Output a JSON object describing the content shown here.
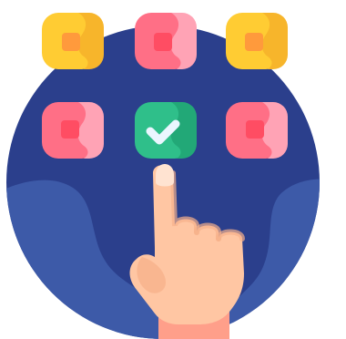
{
  "icon": {
    "semantic": "touch-select-app-icon",
    "palette": {
      "circle_base": "#2B3F8C",
      "circle_highlight": "#3D5AA8",
      "yellow_tile": "#FFCC33",
      "yellow_tile_shade": "#F7B52B",
      "yellow_center": "#FF9A3C",
      "pink_tile": "#FF6F86",
      "pink_tile_light": "#FFA3B5",
      "pink_center": "#FF4D63",
      "green_tile": "#2FBF8A",
      "green_tile_dark": "#22A877",
      "check_color": "#EAF6FF",
      "skin": "#FFC6A3",
      "skin_shade": "#F7B08A",
      "nail": "#FFE3D1",
      "sleeve": "#FF9F8A"
    },
    "tiles": [
      {
        "name": "yellow-app-tile",
        "color": "yellow"
      },
      {
        "name": "pink-app-tile",
        "color": "pink"
      },
      {
        "name": "yellow-app-tile",
        "color": "yellow"
      },
      {
        "name": "pink-app-tile",
        "color": "pink"
      },
      {
        "name": "selected-green-app-tile",
        "color": "green",
        "selected": true
      },
      {
        "name": "pink-app-tile",
        "color": "pink"
      }
    ]
  }
}
